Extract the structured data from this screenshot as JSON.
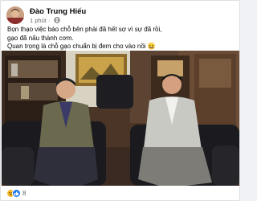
{
  "post": {
    "author": "Đào Trung Hiếu",
    "time": "1 phút",
    "lines": [
      "Bọn thạo việc báo chỗ bên phải đã hết sợ vì sự đã rồi,",
      "gạo đã nấu thành cơm.",
      "Quan trọng là chỗ gạo chuẩn bị đem cho vào nồi 😄"
    ],
    "reaction_count": "8",
    "reaction_icons": [
      "haha-icon",
      "like-icon"
    ]
  },
  "colors": {
    "author_text": "#050505",
    "meta_text": "#65676b",
    "like_blue": "#1877f2",
    "haha_yellow": "#f7b928"
  }
}
